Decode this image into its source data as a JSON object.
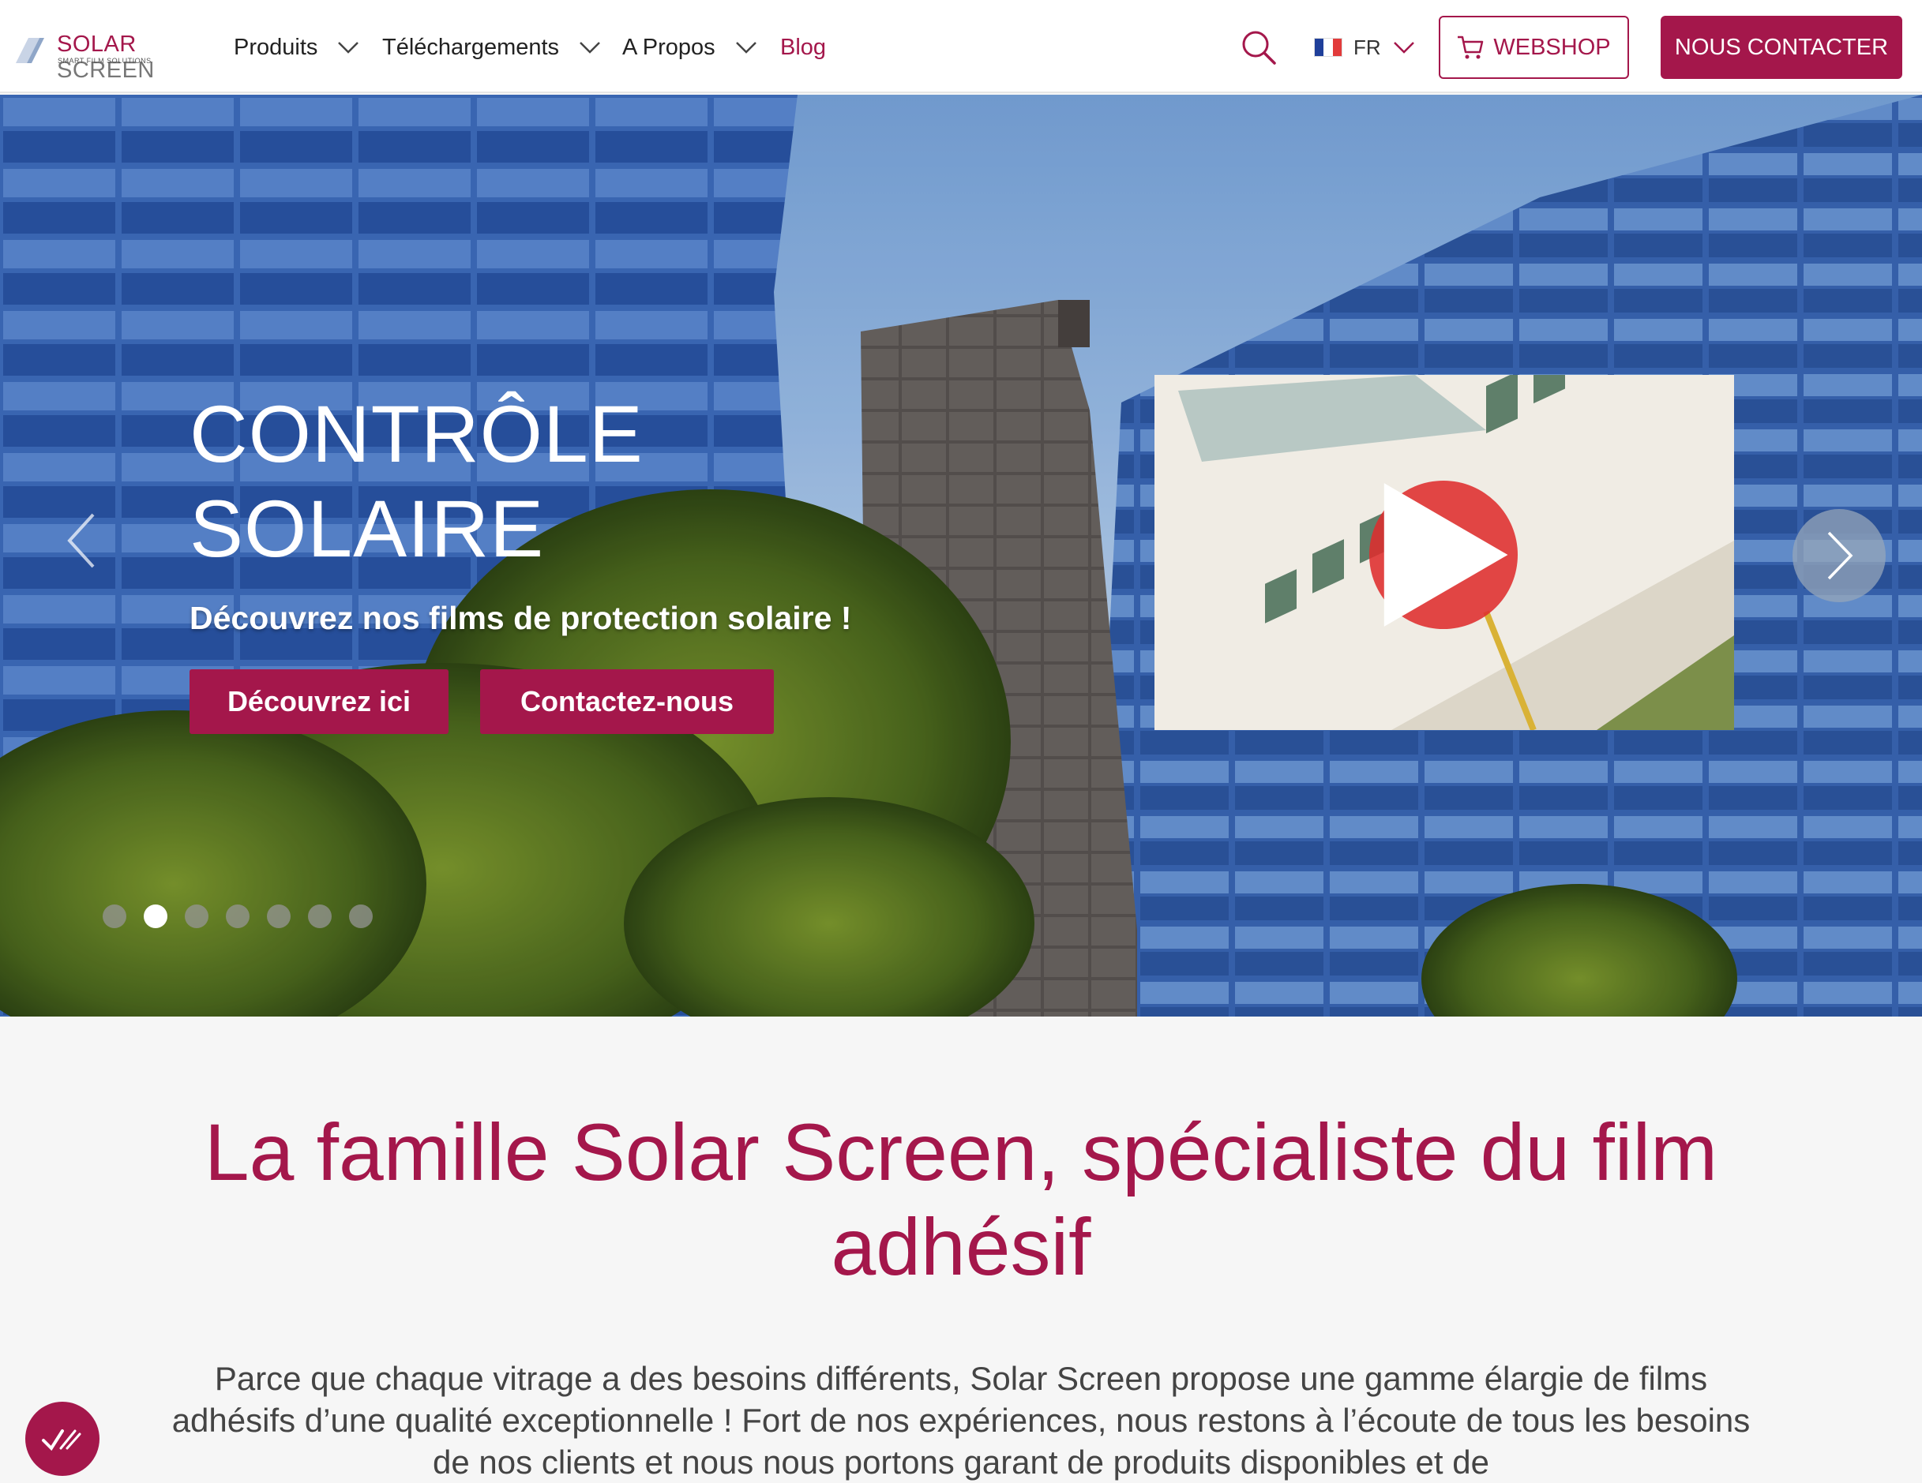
{
  "brand": {
    "logo_solar": "SOLAR",
    "logo_screen": "SCREEN",
    "logo_tagline": "SMART FILM SOLUTIONS",
    "primary_color": "#a4174b"
  },
  "nav": {
    "items": [
      {
        "label": "Produits",
        "has_dropdown": true
      },
      {
        "label": "Téléchargements",
        "has_dropdown": true
      },
      {
        "label": "A Propos",
        "has_dropdown": true
      },
      {
        "label": "Blog",
        "has_dropdown": false
      }
    ],
    "search_icon": "search-icon",
    "language": "FR",
    "webshop_label": "WEBSHOP",
    "contact_label": "NOUS CONTACTER"
  },
  "hero": {
    "title_line1": "CONTRÔLE",
    "title_line2": "SOLAIRE",
    "subtitle": "Découvrez nos films de protection solaire !",
    "button_discover": "Découvrez ici",
    "button_contact": "Contactez-nous",
    "slide_count": 7,
    "active_slide": 2,
    "video_icon": "play-icon"
  },
  "intro": {
    "title": "La famille Solar Screen, spécialiste du film adhésif",
    "text": "Parce que chaque vitrage a des besoins différents, Solar Screen propose une gamme élargie de films adhésifs d’une qualité exceptionnelle ! Fort de nos expériences, nous restons à l’écoute de tous les besoins de nos clients et nous nous portons garant de produits disponibles et de"
  }
}
